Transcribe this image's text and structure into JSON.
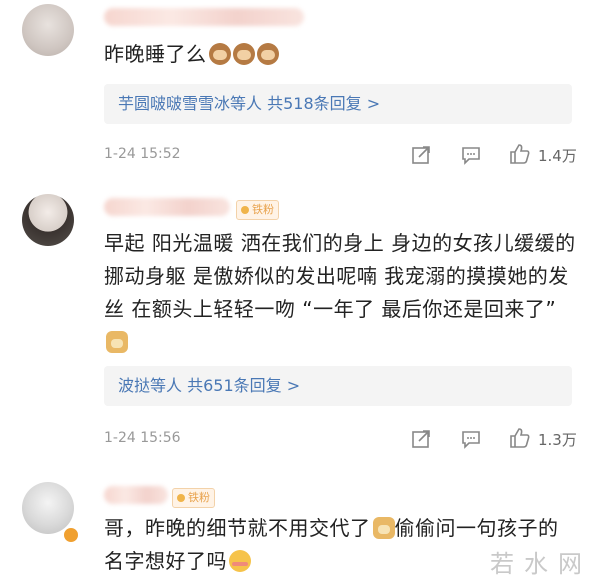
{
  "comments": [
    {
      "text": "昨晚睡了么",
      "emoji": [
        "monkey-face",
        "monkey-face",
        "monkey-face"
      ],
      "reply_summary": "芋圆啵啵雪雪冰等人 共518条回复 >",
      "time": "1-24 15:52",
      "likes": "1.4万"
    },
    {
      "badge": "铁粉",
      "text": "早起 阳光温暖 洒在我们的身上 身边的女孩儿缓缓的挪动身躯 是傲娇似的发出呢喃 我宠溺的摸摸她的发丝 在额头上轻轻一吻 “一年了 最后你还是回来了”",
      "emoji": [
        "doge-face"
      ],
      "reply_summary": "波挞等人 共651条回复 >",
      "time": "1-24 15:56",
      "likes": "1.3万"
    },
    {
      "badge": "铁粉",
      "text_part1": "哥，昨晚的细节就不用交代了",
      "text_part2": "偷偷问一句孩子的名字想好了吗",
      "emoji": [
        "doge-face",
        "blush-face"
      ]
    }
  ],
  "watermark": "若水网",
  "icons": {
    "share": "share-icon",
    "comment": "comment-icon",
    "like": "thumbs-up-icon"
  }
}
